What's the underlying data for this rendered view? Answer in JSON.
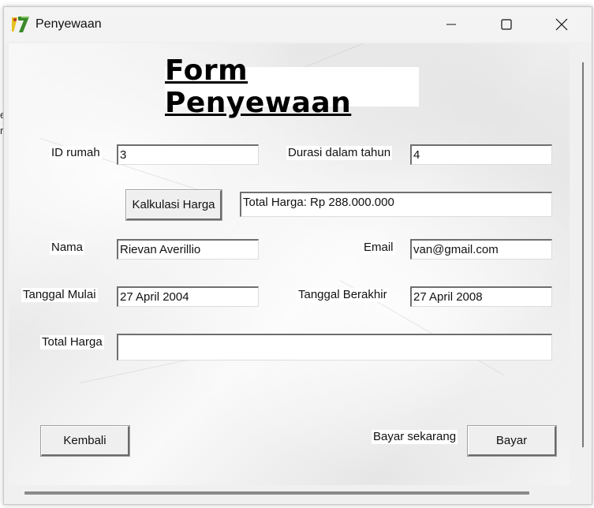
{
  "window": {
    "title": "Penyewaan"
  },
  "form": {
    "heading": "Form Penyewaan",
    "id_rumah": {
      "label": "ID rumah",
      "value": "3"
    },
    "durasi": {
      "label": "Durasi dalam tahun",
      "value": "4"
    },
    "kalkulasi_button": "Kalkulasi Harga",
    "total_harga_output": "Total Harga: Rp 288.000.000",
    "nama": {
      "label": "Nama",
      "value": "Rievan Averillio"
    },
    "email": {
      "label": "Email",
      "value": "van@gmail.com"
    },
    "tanggal_mulai": {
      "label": "Tanggal Mulai",
      "value": "27 April 2004"
    },
    "tanggal_berakhir": {
      "label": "Tanggal Berakhir",
      "value": "27 April 2008"
    },
    "total_harga": {
      "label": "Total Harga",
      "value": ""
    },
    "kembali_button": "Kembali",
    "bayar_label": "Bayar sekarang",
    "bayar_button": "Bayar"
  },
  "colors": {
    "window_bg": "#f0f0f0",
    "field_bg": "#ffffff",
    "icon_green": "#3a8a2a",
    "icon_yellow": "#e8c21c"
  },
  "icons": {
    "app": "app-icon",
    "minimize": "minimize-icon",
    "maximize": "maximize-icon",
    "close": "close-icon"
  }
}
